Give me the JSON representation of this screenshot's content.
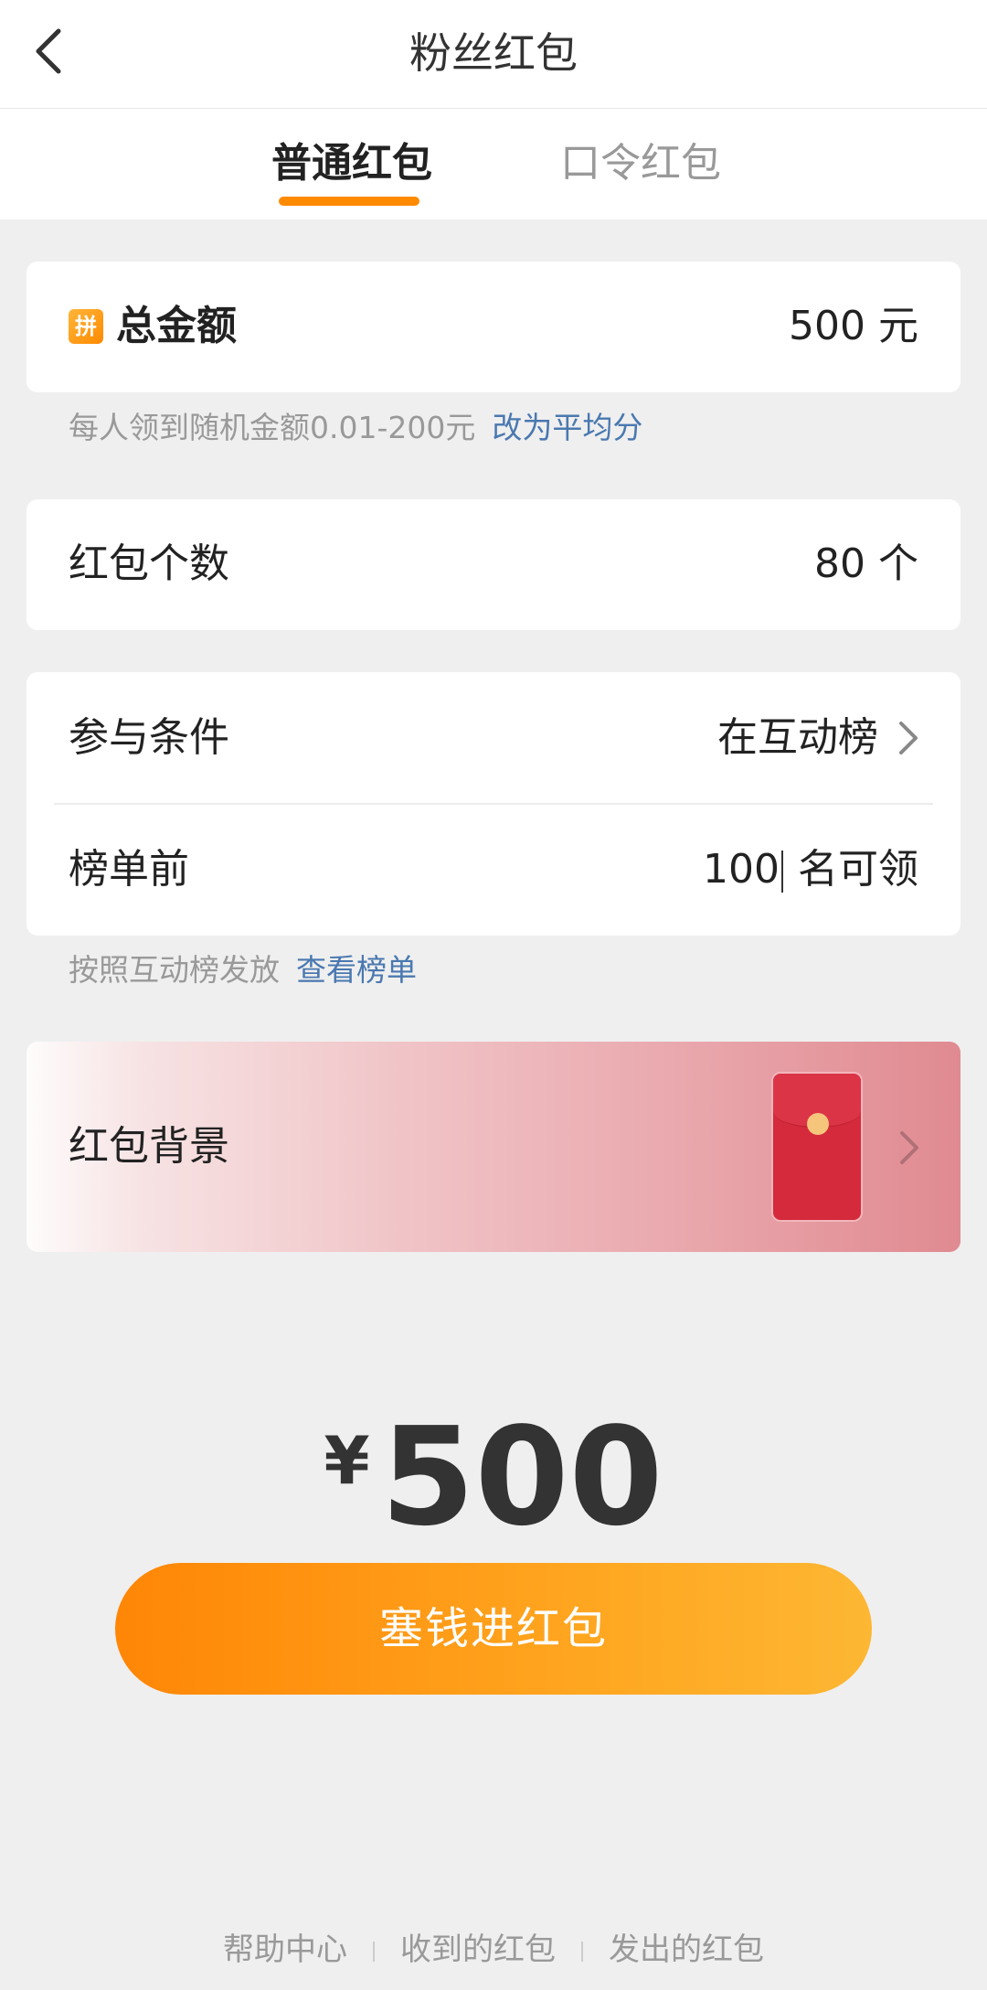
{
  "header": {
    "title": "粉丝红包"
  },
  "tabs": [
    {
      "label": "普通红包",
      "active": true
    },
    {
      "label": "口令红包",
      "active": false
    }
  ],
  "total_amount": {
    "badge": "拼",
    "label": "总金额",
    "value": "500",
    "unit": "元",
    "hint": "每人领到随机金额0.01-200元",
    "hint_link": "改为平均分"
  },
  "count": {
    "label": "红包个数",
    "value": "80",
    "unit": "个"
  },
  "condition": {
    "label": "参与条件",
    "value": "在互动榜"
  },
  "rank": {
    "label": "榜单前",
    "value": "100",
    "suffix": "名可领",
    "hint": "按照互动榜发放",
    "hint_link": "查看榜单"
  },
  "background": {
    "label": "红包背景"
  },
  "summary": {
    "currency": "¥",
    "amount": "500"
  },
  "submit": {
    "label": "塞钱进红包"
  },
  "footer": {
    "links": [
      "帮助中心",
      "收到的红包",
      "发出的红包"
    ]
  },
  "colors": {
    "accent": "#ff8a00",
    "link": "#4a78b0",
    "envelope": "#d42a3c"
  }
}
